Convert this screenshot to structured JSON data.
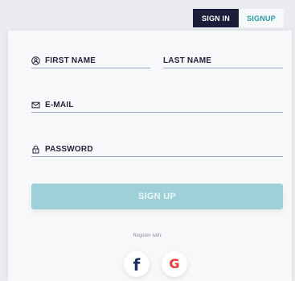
{
  "tabs": {
    "signin_label": "SIGN IN",
    "signup_label": "SIGNUP"
  },
  "form": {
    "first_name_label": "FIRST NAME",
    "last_name_label": "LAST NAME",
    "email_label": "E-MAIL",
    "password_label": "PASSWORD",
    "submit_label": "SIGN UP"
  },
  "social": {
    "register_text": "Register with:",
    "facebook_glyph": "f",
    "google_glyph": "G"
  },
  "icons": {
    "first_name": "user-icon",
    "email": "envelope-icon",
    "password": "lock-icon",
    "facebook": "facebook-icon",
    "google": "google-icon"
  },
  "colors": {
    "background": "#e9ebee",
    "card": "#f7f8fa",
    "tab_active_bg": "#1b1d3a",
    "tab_inactive_text": "#2a9aa8",
    "field_line": "#9fa7c2",
    "button_bg": "#9fd0d8",
    "label_text": "#23233b"
  }
}
